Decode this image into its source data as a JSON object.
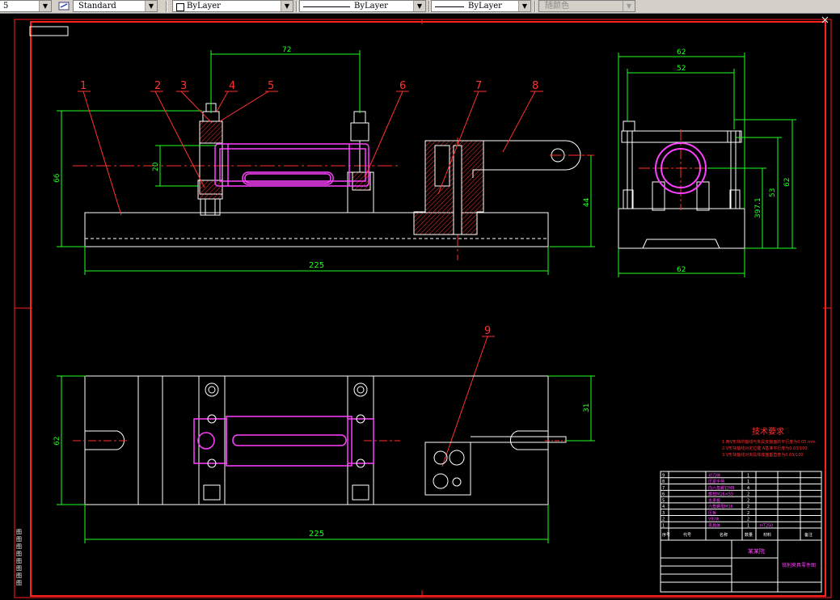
{
  "toolbar": {
    "style_name": "Standard",
    "layer": "ByLayer",
    "linetype": "ByLayer",
    "lineweight": "ByLayer",
    "plot_style": "随颜色"
  },
  "drawing": {
    "top_dims": {
      "d72": "72",
      "d66": "66",
      "d20": "20",
      "d44": "44",
      "d225": "225"
    },
    "side_dims": {
      "d62a": "62",
      "d52": "52",
      "d62b": "62",
      "d53": "53",
      "d397": "397.1",
      "d62c": "62"
    },
    "plan_dims": {
      "d31": "31",
      "d62": "62",
      "d225": "225"
    },
    "balloons": [
      "1",
      "2",
      "3",
      "4",
      "5",
      "6",
      "7",
      "8",
      "9"
    ],
    "tech_title": "技术要求",
    "tech_lines": [
      "1.两V形块的轴线与夹具安装面的平行度为0.05 mm",
      "2.V形块轴线对定位键  A基准平行度为0.03/100",
      "3.V形块轴线对夹具体底面垂直度为0.03/100"
    ],
    "bom_rows": [
      {
        "no": "9",
        "name": "对刀块",
        "qty": "1"
      },
      {
        "no": "8",
        "name": "压紧手柄",
        "qty": "1"
      },
      {
        "no": "7",
        "name": "内六角螺钉M8",
        "qty": "4"
      },
      {
        "no": "6",
        "name": "螺柱M16×55",
        "qty": "2"
      },
      {
        "no": "5",
        "name": "支承板",
        "qty": "2"
      },
      {
        "no": "4",
        "name": "六角螺母M16",
        "qty": "2"
      },
      {
        "no": "3",
        "name": "压板",
        "qty": "2"
      },
      {
        "no": "2",
        "name": "V形块",
        "qty": "2"
      },
      {
        "no": "1",
        "name": "夹具体",
        "qty": "1",
        "material": "HT250"
      }
    ],
    "bom_header": [
      "序号",
      "代号",
      "名称",
      "数量",
      "材料",
      "备注"
    ],
    "title_block": {
      "company": "某某院",
      "drawing_name": "铣削夹具零件图"
    },
    "left_legend": [
      "图",
      "图",
      "图",
      "图",
      "图",
      "图",
      "图",
      "图"
    ]
  }
}
